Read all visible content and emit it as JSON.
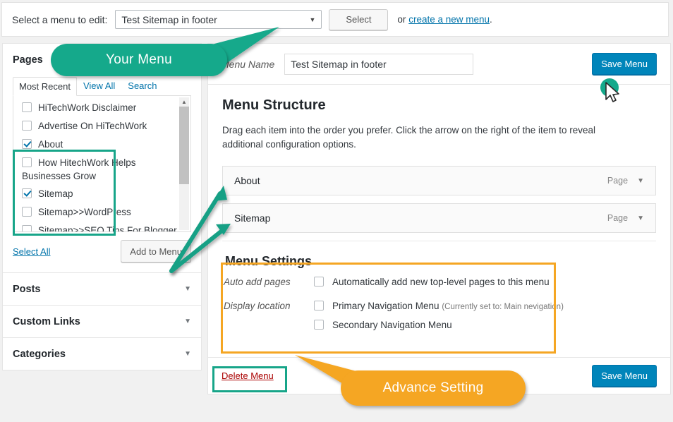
{
  "topbar": {
    "label": "Select a menu to edit:",
    "selected_menu": "Test Sitemap in footer",
    "select_button": "Select",
    "or_text": "or",
    "create_link": "create a new menu",
    "period": "."
  },
  "sidebar": {
    "pages_panel": {
      "title": "Pages",
      "tabs": [
        {
          "label": "Most Recent",
          "active": true
        },
        {
          "label": "View All",
          "active": false
        },
        {
          "label": "Search",
          "active": false
        }
      ],
      "items": [
        {
          "label": "HiTechWork Disclaimer",
          "checked": false
        },
        {
          "label": "Advertise On HiTechWork",
          "checked": false
        },
        {
          "label": "About",
          "checked": true
        },
        {
          "label": "How HitechWork Helps",
          "checked": false,
          "continuation": "Businesses Grow"
        },
        {
          "label": "Sitemap",
          "checked": true
        },
        {
          "label": "Sitemap>>WordPress",
          "checked": false
        },
        {
          "label": "Sitemap>>SEO Tips For Blogger",
          "checked": false
        }
      ],
      "select_all": "Select All",
      "add_to_menu": "Add to Menu"
    },
    "accordions": [
      {
        "label": "Posts"
      },
      {
        "label": "Custom Links"
      },
      {
        "label": "Categories"
      }
    ]
  },
  "main": {
    "menu_name_label": "Menu Name",
    "menu_name_value": "Test Sitemap in footer",
    "save_menu_top": "Save Menu",
    "structure_title": "Menu Structure",
    "structure_desc": "Drag each item into the order you prefer. Click the arrow on the right of the item to reveal additional configuration options.",
    "menu_items": [
      {
        "name": "About",
        "type": "Page"
      },
      {
        "name": "Sitemap",
        "type": "Page"
      }
    ],
    "settings": {
      "title": "Menu Settings",
      "auto_add_label": "Auto add pages",
      "auto_add_option": "Automatically add new top-level pages to this menu",
      "auto_add_checked": false,
      "display_label": "Display location",
      "locations": [
        {
          "label": "Primary Navigation Menu",
          "hint": "(Currently set to: Main nevigation)",
          "checked": false
        },
        {
          "label": "Secondary Navigation Menu",
          "hint": "",
          "checked": false
        }
      ]
    },
    "delete_menu": "Delete Menu",
    "save_menu_bottom": "Save Menu"
  },
  "annotations": {
    "green_callout": "Your Menu",
    "orange_callout": "Advance Setting",
    "colors": {
      "green": "#15a98b",
      "orange": "#f5a623",
      "highlight_border": "#17a589",
      "save_button": "#0085ba",
      "link": "#0073aa",
      "delete_link": "#aa0000"
    }
  }
}
